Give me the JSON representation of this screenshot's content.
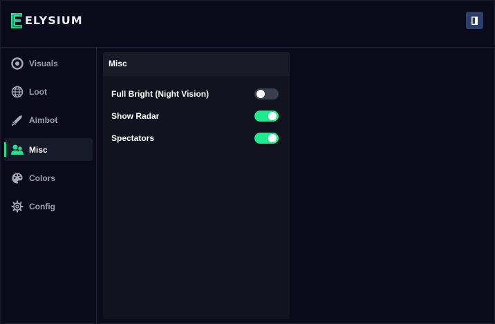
{
  "app": {
    "name": "ELYSIUM",
    "accent_color": "#1ee98f",
    "exit_icon": "door-exit-icon"
  },
  "sidebar": {
    "items": [
      {
        "label": "Visuals",
        "icon": "eye-circle-icon",
        "active": false
      },
      {
        "label": "Loot",
        "icon": "globe-icon",
        "active": false
      },
      {
        "label": "Aimbot",
        "icon": "sword-icon",
        "active": false
      },
      {
        "label": "Misc",
        "icon": "users-icon",
        "active": true
      },
      {
        "label": "Colors",
        "icon": "palette-icon",
        "active": false
      },
      {
        "label": "Config",
        "icon": "gear-icon",
        "active": false
      }
    ]
  },
  "panel": {
    "title": "Misc",
    "options": [
      {
        "label": "Full Bright (Night Vision)",
        "enabled": false
      },
      {
        "label": "Show Radar",
        "enabled": true
      },
      {
        "label": "Spectators",
        "enabled": true
      }
    ]
  }
}
